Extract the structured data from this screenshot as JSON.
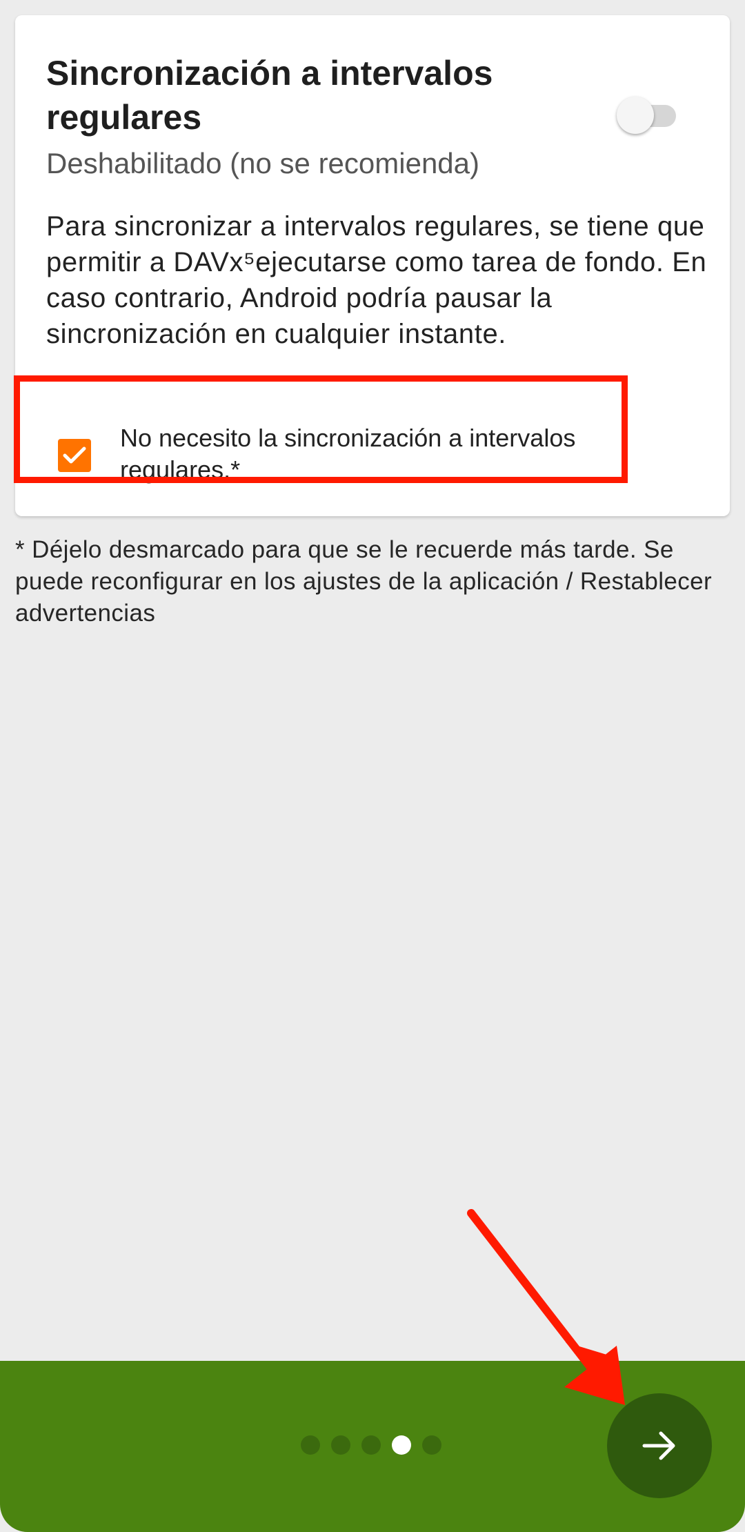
{
  "card": {
    "title": "Sincronización a intervalos regulares",
    "subtitle": "Deshabilitado (no se recomienda)",
    "toggle_state": "off",
    "body": "Para sincronizar a intervalos regulares, se tiene que permitir a DAVx⁵ejecutarse como tarea de fondo. En caso contrario, Android podría pausar la sincronización en cualquier instante.",
    "checkbox_label": "No necesito la sincronización a intervalos regulares.*",
    "checkbox_checked": true
  },
  "footnote": "* Déjelo desmarcado para que se le recuerde más tarde. Se puede reconfigurar en los ajustes de la aplicación / Restablecer advertencias",
  "pager": {
    "total": 5,
    "active_index": 3
  },
  "colors": {
    "accent": "#ff7300",
    "bottom_bar": "#4b8410",
    "next_button": "#2f5a0d",
    "annotation": "#ff1a00"
  },
  "icons": {
    "next": "arrow-right-icon",
    "check": "checkmark-icon"
  }
}
